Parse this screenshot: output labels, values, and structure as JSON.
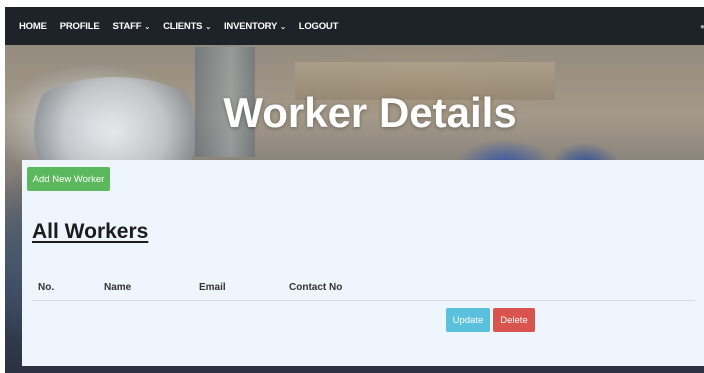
{
  "navbar": {
    "items": [
      {
        "label": "HOME",
        "dropdown": false
      },
      {
        "label": "PROFILE",
        "dropdown": false
      },
      {
        "label": "STAFF",
        "dropdown": true
      },
      {
        "label": "CLIENTS",
        "dropdown": true
      },
      {
        "label": "INVENTORY",
        "dropdown": true
      },
      {
        "label": "LOGOUT",
        "dropdown": false
      }
    ],
    "caret_icon": "chevron-down-icon"
  },
  "hero": {
    "title": "Worker Details"
  },
  "panel": {
    "add_button_label": "Add New Worker",
    "section_title": "All Workers",
    "table": {
      "columns": [
        "No.",
        "Name",
        "Email",
        "Contact No"
      ],
      "rows": []
    },
    "update_button_label": "Update",
    "delete_button_label": "Delete"
  },
  "colors": {
    "navbar_bg": "#1d2329",
    "panel_bg": "#eef5fc",
    "success": "#5cb85c",
    "info": "#5bc0de",
    "danger": "#d9534f"
  }
}
